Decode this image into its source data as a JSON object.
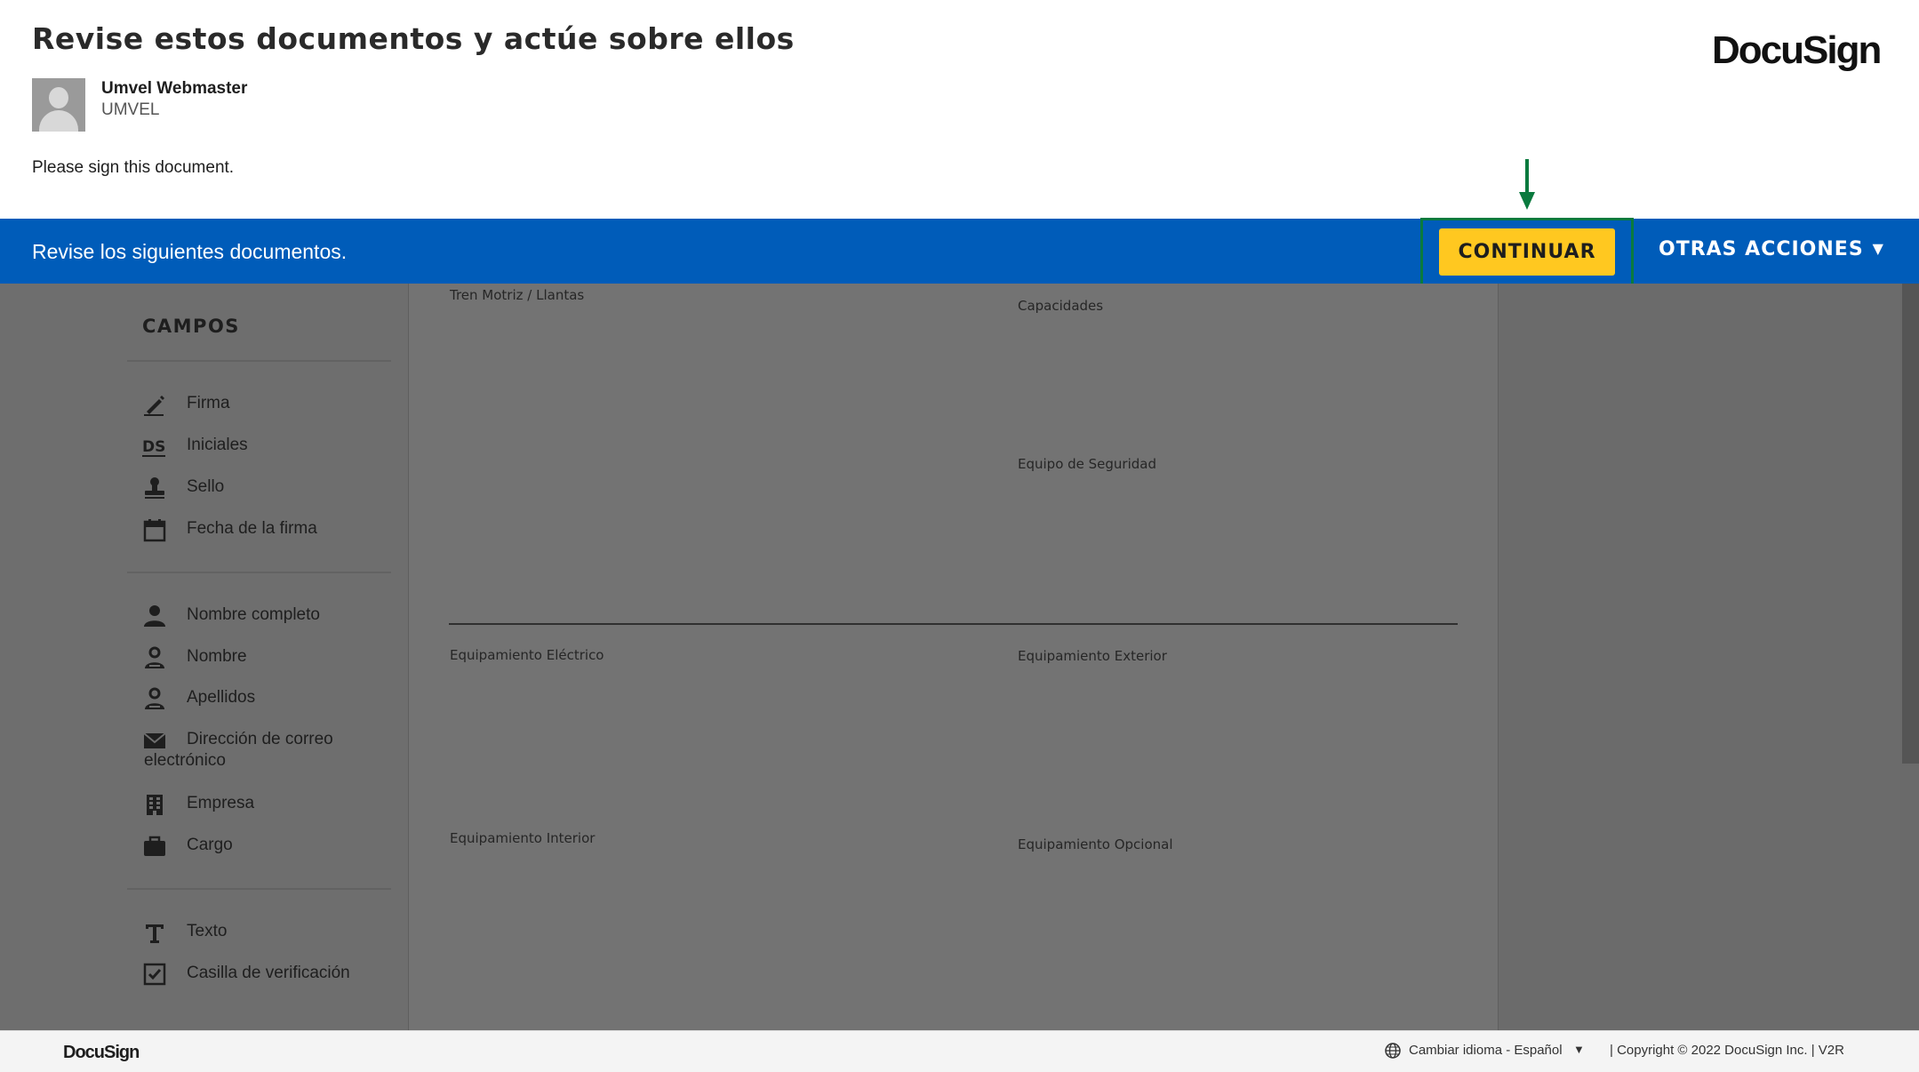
{
  "header": {
    "title": "Revise estos documentos y actúe sobre ellos",
    "logo": "DocuSign",
    "sender_name": "Umvel Webmaster",
    "sender_company": "UMVEL",
    "message": "Please sign this document."
  },
  "actionbar": {
    "text": "Revise los siguientes documentos.",
    "continue_label": "CONTINUAR",
    "other_actions_label": "OTRAS ACCIONES",
    "continue_color": "#ffc820",
    "bar_color": "#005cb9",
    "highlight_color": "#0a7a3e"
  },
  "sidebar": {
    "title": "CAMPOS",
    "groups": [
      [
        {
          "label": "Firma",
          "icon": "pen-icon"
        },
        {
          "label": "Iniciales",
          "icon": "ds-initials-icon"
        },
        {
          "label": "Sello",
          "icon": "stamp-icon"
        },
        {
          "label": "Fecha de la firma",
          "icon": "calendar-icon"
        }
      ],
      [
        {
          "label": "Nombre completo",
          "icon": "person-icon"
        },
        {
          "label": "Nombre",
          "icon": "person-outline-icon"
        },
        {
          "label": "Apellidos",
          "icon": "person-outline-icon"
        },
        {
          "label": "Dirección de correo",
          "label2": "electrónico",
          "icon": "envelope-icon"
        },
        {
          "label": "Empresa",
          "icon": "building-icon"
        },
        {
          "label": "Cargo",
          "icon": "briefcase-icon"
        }
      ],
      [
        {
          "label": "Texto",
          "icon": "text-icon"
        },
        {
          "label": "Casilla de verificación",
          "icon": "checkbox-icon"
        }
      ]
    ]
  },
  "document": {
    "labels": [
      "Tren Motriz / Llantas",
      "Capacidades",
      "Equipo de Seguridad",
      "Equipamiento Eléctrico",
      "Equipamiento Exterior",
      "Equipamiento Interior",
      "Equipamiento Opcional"
    ]
  },
  "footer": {
    "logo": "DocuSign",
    "language": "Cambiar idioma - Español",
    "copyright": "|   Copyright © 2022 DocuSign Inc.  |  V2R"
  }
}
